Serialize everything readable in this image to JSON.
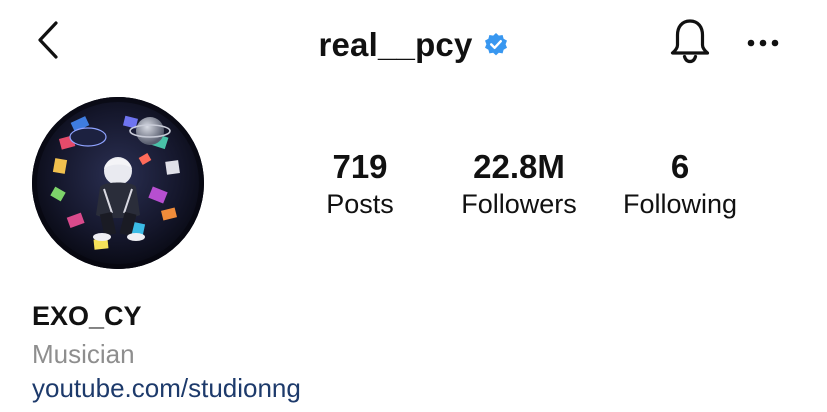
{
  "header": {
    "username": "real__pcy",
    "verified": true,
    "back_icon": "chevron-left-icon",
    "verified_icon": "verified-badge-icon",
    "notifications_icon": "bell-icon",
    "more_icon": "more-horizontal-icon"
  },
  "profile": {
    "avatar_icon": "profile-avatar",
    "stats": [
      {
        "count": "719",
        "label": "Posts"
      },
      {
        "count": "22.8M",
        "label": "Followers"
      },
      {
        "count": "6",
        "label": "Following"
      }
    ],
    "display_name": "EXO_CY",
    "category": "Musician",
    "link": "youtube.com/studionng"
  },
  "colors": {
    "text": "#111111",
    "secondary_text": "#8e8e8e",
    "link": "#1d3a6b",
    "verified": "#3897f0",
    "background": "#ffffff"
  }
}
